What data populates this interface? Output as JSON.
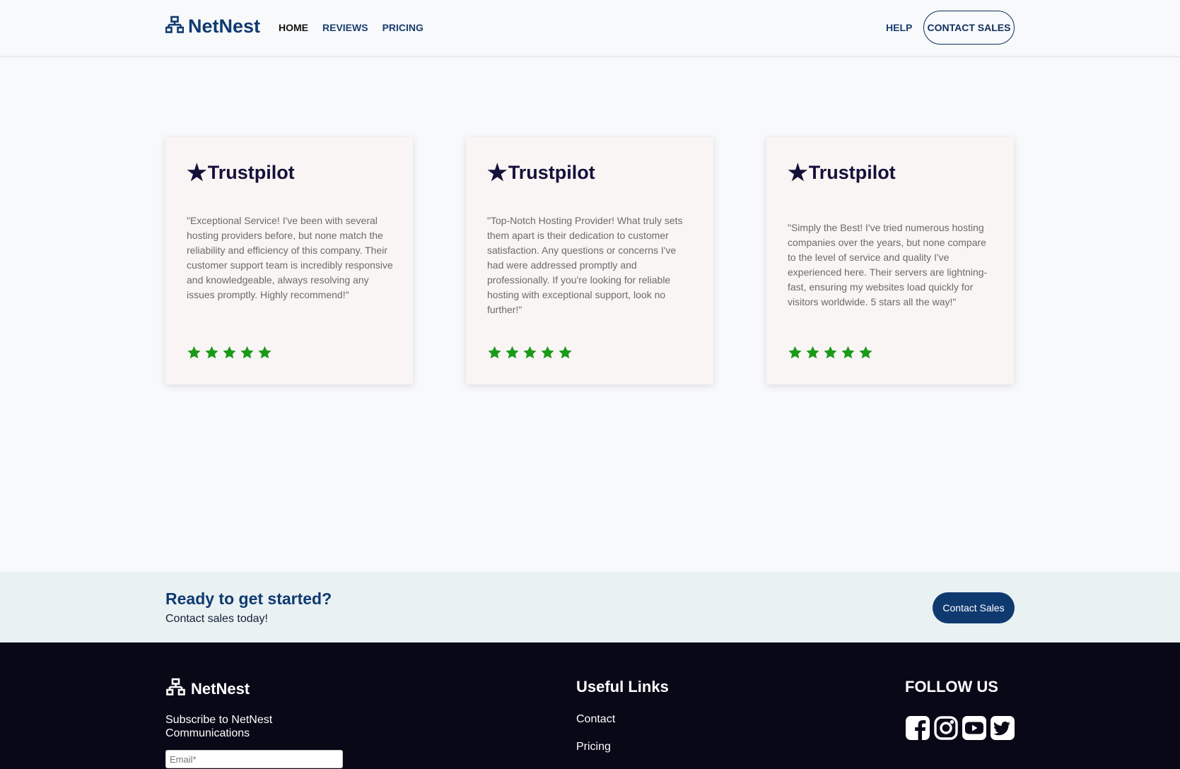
{
  "colors": {
    "primary": "#0f3a70",
    "star_green": "#1a9a19",
    "footer_bg": "#090817",
    "cta_bg": "#e9f1f2"
  },
  "header": {
    "brand": "NetNest",
    "brand_icon": "network-icon",
    "nav": [
      "HOME",
      "REVIEWS",
      "PRICING"
    ],
    "help": "HELP",
    "contact": "CONTACT SALES"
  },
  "reviews": [
    {
      "source": "Trustpilot",
      "text": "\"Exceptional Service! I've been with several hosting providers before, but none match the reliability and efficiency of this company. Their customer support team is incredibly responsive and knowledgeable, always resolving any issues promptly. Highly recommend!\"",
      "rating": 5
    },
    {
      "source": "Trustpilot",
      "text": "\"Top-Notch Hosting Provider! What truly sets them apart is their dedication to customer satisfaction. Any questions or concerns I've had were addressed promptly and professionally. If you're looking for reliable hosting with exceptional support, look no further!\"",
      "rating": 5
    },
    {
      "source": "Trustpilot",
      "text": "\"Simply the Best! I've tried numerous hosting companies over the years, but none compare to the level of service and quality I've experienced here. Their servers are lightning-fast, ensuring my websites load quickly for visitors worldwide. 5 stars all the way!\"",
      "rating": 5
    }
  ],
  "cta": {
    "title": "Ready to get started?",
    "subtitle": "Contact sales today!",
    "button": "Contact Sales"
  },
  "footer": {
    "brand": "NetNest",
    "subscribe": "Subscribe to NetNest Communications",
    "email_placeholder": "Email*",
    "links_title": "Useful Links",
    "links": [
      "Contact",
      "Pricing"
    ],
    "follow_title": "FOLLOW US",
    "socials": [
      "facebook-icon",
      "instagram-icon",
      "youtube-icon",
      "twitter-icon"
    ]
  }
}
